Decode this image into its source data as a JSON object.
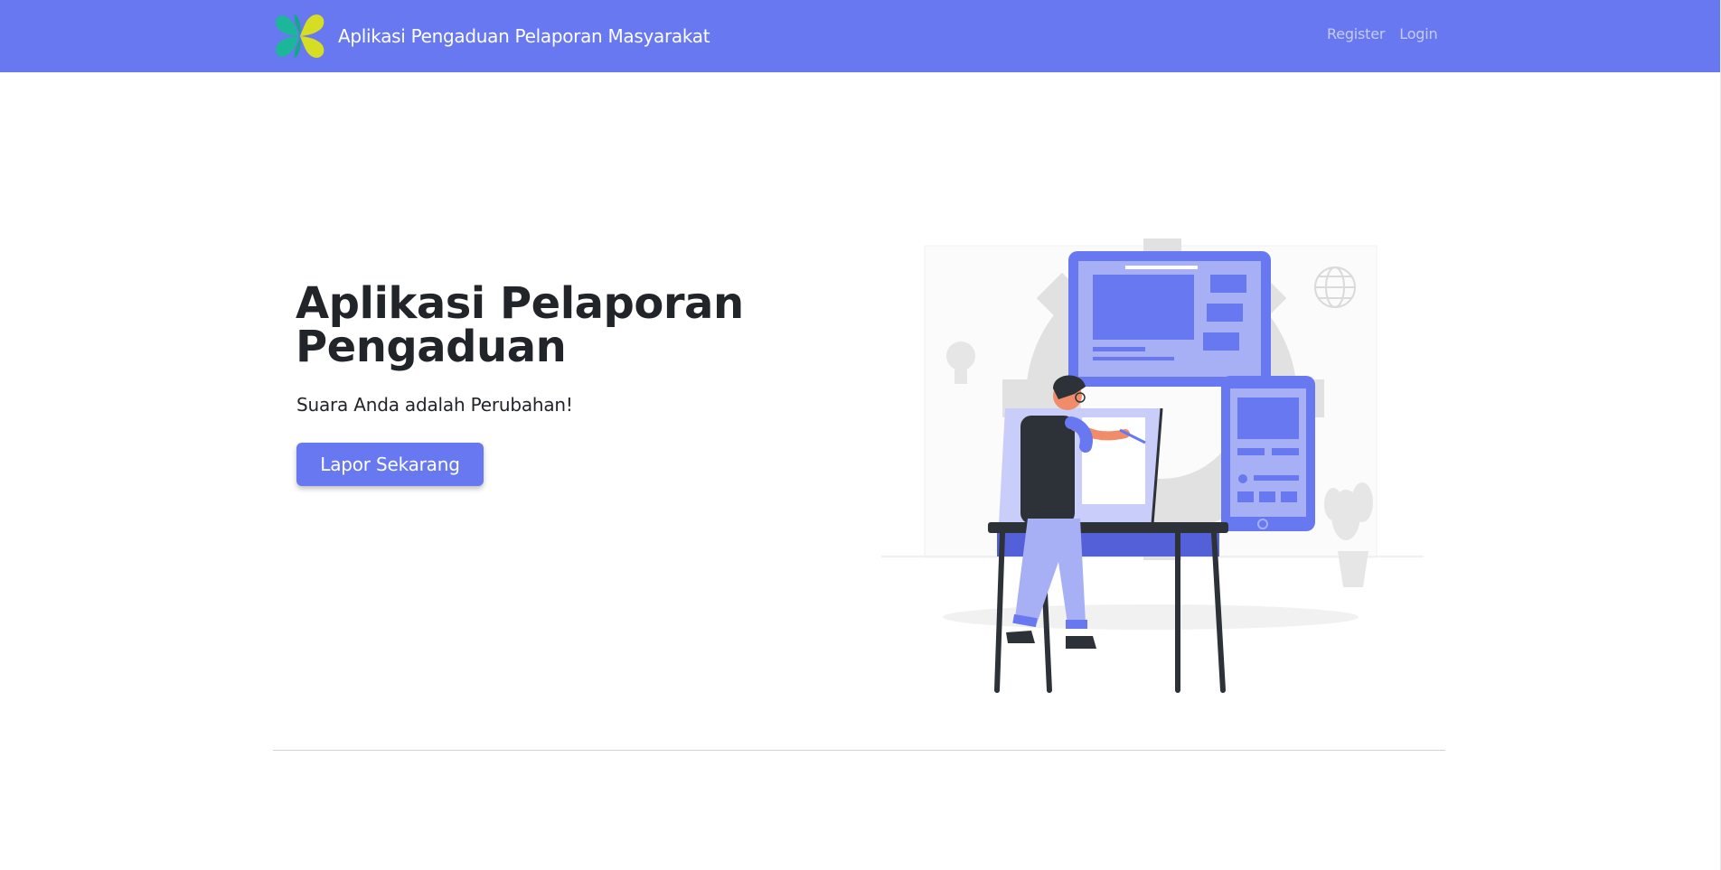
{
  "navbar": {
    "brand_title": "Aplikasi Pengaduan Pelaporan Masyarakat",
    "logo_icon": "kemenkes-logo-icon",
    "links": [
      {
        "label": "Register"
      },
      {
        "label": "Login"
      }
    ]
  },
  "hero": {
    "title": "Aplikasi Pelaporan Pengaduan",
    "subtitle": "Suara Anda adalah Perubahan!",
    "cta_label": "Lapor Sekarang",
    "illustration_icon": "designer-at-desk-illustration"
  },
  "colors": {
    "primary": "#6878f0",
    "text_dark": "#212529",
    "white": "#ffffff",
    "logo_teal": "#1cb79a",
    "logo_yellow": "#d6de23"
  }
}
